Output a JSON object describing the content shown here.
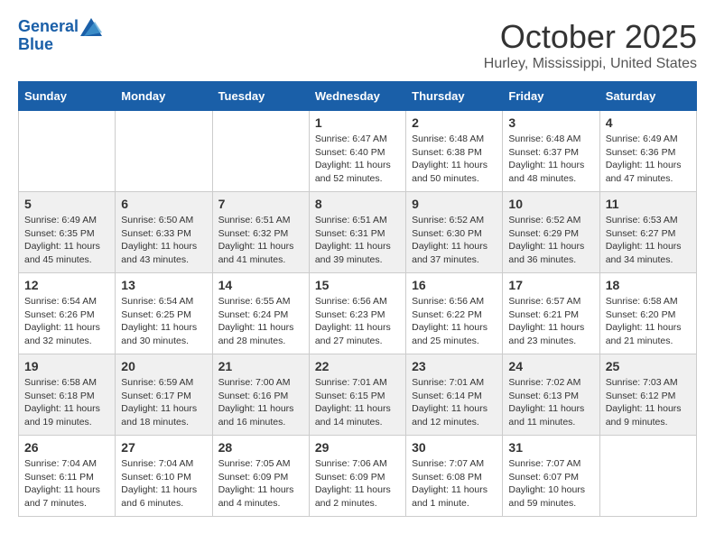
{
  "header": {
    "logo_line1": "General",
    "logo_line2": "Blue",
    "month_title": "October 2025",
    "location": "Hurley, Mississippi, United States"
  },
  "weekdays": [
    "Sunday",
    "Monday",
    "Tuesday",
    "Wednesday",
    "Thursday",
    "Friday",
    "Saturday"
  ],
  "weeks": [
    [
      {
        "day": "",
        "sunrise": "",
        "sunset": "",
        "daylight": ""
      },
      {
        "day": "",
        "sunrise": "",
        "sunset": "",
        "daylight": ""
      },
      {
        "day": "",
        "sunrise": "",
        "sunset": "",
        "daylight": ""
      },
      {
        "day": "1",
        "sunrise": "Sunrise: 6:47 AM",
        "sunset": "Sunset: 6:40 PM",
        "daylight": "Daylight: 11 hours and 52 minutes."
      },
      {
        "day": "2",
        "sunrise": "Sunrise: 6:48 AM",
        "sunset": "Sunset: 6:38 PM",
        "daylight": "Daylight: 11 hours and 50 minutes."
      },
      {
        "day": "3",
        "sunrise": "Sunrise: 6:48 AM",
        "sunset": "Sunset: 6:37 PM",
        "daylight": "Daylight: 11 hours and 48 minutes."
      },
      {
        "day": "4",
        "sunrise": "Sunrise: 6:49 AM",
        "sunset": "Sunset: 6:36 PM",
        "daylight": "Daylight: 11 hours and 47 minutes."
      }
    ],
    [
      {
        "day": "5",
        "sunrise": "Sunrise: 6:49 AM",
        "sunset": "Sunset: 6:35 PM",
        "daylight": "Daylight: 11 hours and 45 minutes."
      },
      {
        "day": "6",
        "sunrise": "Sunrise: 6:50 AM",
        "sunset": "Sunset: 6:33 PM",
        "daylight": "Daylight: 11 hours and 43 minutes."
      },
      {
        "day": "7",
        "sunrise": "Sunrise: 6:51 AM",
        "sunset": "Sunset: 6:32 PM",
        "daylight": "Daylight: 11 hours and 41 minutes."
      },
      {
        "day": "8",
        "sunrise": "Sunrise: 6:51 AM",
        "sunset": "Sunset: 6:31 PM",
        "daylight": "Daylight: 11 hours and 39 minutes."
      },
      {
        "day": "9",
        "sunrise": "Sunrise: 6:52 AM",
        "sunset": "Sunset: 6:30 PM",
        "daylight": "Daylight: 11 hours and 37 minutes."
      },
      {
        "day": "10",
        "sunrise": "Sunrise: 6:52 AM",
        "sunset": "Sunset: 6:29 PM",
        "daylight": "Daylight: 11 hours and 36 minutes."
      },
      {
        "day": "11",
        "sunrise": "Sunrise: 6:53 AM",
        "sunset": "Sunset: 6:27 PM",
        "daylight": "Daylight: 11 hours and 34 minutes."
      }
    ],
    [
      {
        "day": "12",
        "sunrise": "Sunrise: 6:54 AM",
        "sunset": "Sunset: 6:26 PM",
        "daylight": "Daylight: 11 hours and 32 minutes."
      },
      {
        "day": "13",
        "sunrise": "Sunrise: 6:54 AM",
        "sunset": "Sunset: 6:25 PM",
        "daylight": "Daylight: 11 hours and 30 minutes."
      },
      {
        "day": "14",
        "sunrise": "Sunrise: 6:55 AM",
        "sunset": "Sunset: 6:24 PM",
        "daylight": "Daylight: 11 hours and 28 minutes."
      },
      {
        "day": "15",
        "sunrise": "Sunrise: 6:56 AM",
        "sunset": "Sunset: 6:23 PM",
        "daylight": "Daylight: 11 hours and 27 minutes."
      },
      {
        "day": "16",
        "sunrise": "Sunrise: 6:56 AM",
        "sunset": "Sunset: 6:22 PM",
        "daylight": "Daylight: 11 hours and 25 minutes."
      },
      {
        "day": "17",
        "sunrise": "Sunrise: 6:57 AM",
        "sunset": "Sunset: 6:21 PM",
        "daylight": "Daylight: 11 hours and 23 minutes."
      },
      {
        "day": "18",
        "sunrise": "Sunrise: 6:58 AM",
        "sunset": "Sunset: 6:20 PM",
        "daylight": "Daylight: 11 hours and 21 minutes."
      }
    ],
    [
      {
        "day": "19",
        "sunrise": "Sunrise: 6:58 AM",
        "sunset": "Sunset: 6:18 PM",
        "daylight": "Daylight: 11 hours and 19 minutes."
      },
      {
        "day": "20",
        "sunrise": "Sunrise: 6:59 AM",
        "sunset": "Sunset: 6:17 PM",
        "daylight": "Daylight: 11 hours and 18 minutes."
      },
      {
        "day": "21",
        "sunrise": "Sunrise: 7:00 AM",
        "sunset": "Sunset: 6:16 PM",
        "daylight": "Daylight: 11 hours and 16 minutes."
      },
      {
        "day": "22",
        "sunrise": "Sunrise: 7:01 AM",
        "sunset": "Sunset: 6:15 PM",
        "daylight": "Daylight: 11 hours and 14 minutes."
      },
      {
        "day": "23",
        "sunrise": "Sunrise: 7:01 AM",
        "sunset": "Sunset: 6:14 PM",
        "daylight": "Daylight: 11 hours and 12 minutes."
      },
      {
        "day": "24",
        "sunrise": "Sunrise: 7:02 AM",
        "sunset": "Sunset: 6:13 PM",
        "daylight": "Daylight: 11 hours and 11 minutes."
      },
      {
        "day": "25",
        "sunrise": "Sunrise: 7:03 AM",
        "sunset": "Sunset: 6:12 PM",
        "daylight": "Daylight: 11 hours and 9 minutes."
      }
    ],
    [
      {
        "day": "26",
        "sunrise": "Sunrise: 7:04 AM",
        "sunset": "Sunset: 6:11 PM",
        "daylight": "Daylight: 11 hours and 7 minutes."
      },
      {
        "day": "27",
        "sunrise": "Sunrise: 7:04 AM",
        "sunset": "Sunset: 6:10 PM",
        "daylight": "Daylight: 11 hours and 6 minutes."
      },
      {
        "day": "28",
        "sunrise": "Sunrise: 7:05 AM",
        "sunset": "Sunset: 6:09 PM",
        "daylight": "Daylight: 11 hours and 4 minutes."
      },
      {
        "day": "29",
        "sunrise": "Sunrise: 7:06 AM",
        "sunset": "Sunset: 6:09 PM",
        "daylight": "Daylight: 11 hours and 2 minutes."
      },
      {
        "day": "30",
        "sunrise": "Sunrise: 7:07 AM",
        "sunset": "Sunset: 6:08 PM",
        "daylight": "Daylight: 11 hours and 1 minute."
      },
      {
        "day": "31",
        "sunrise": "Sunrise: 7:07 AM",
        "sunset": "Sunset: 6:07 PM",
        "daylight": "Daylight: 10 hours and 59 minutes."
      },
      {
        "day": "",
        "sunrise": "",
        "sunset": "",
        "daylight": ""
      }
    ]
  ]
}
